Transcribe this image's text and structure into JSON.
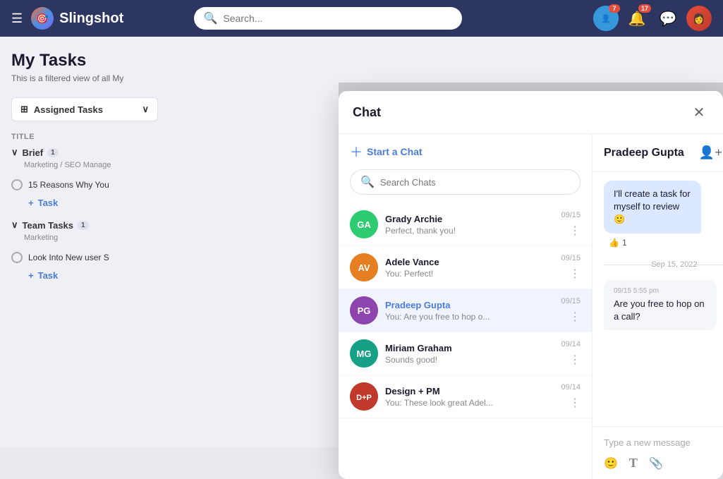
{
  "app": {
    "name": "Slingshot",
    "search_placeholder": "Search..."
  },
  "nav": {
    "badges": {
      "notifications": "7",
      "alerts": "17"
    }
  },
  "sidebar": {
    "title": "My Tasks",
    "subtitle": "This is a filtered view of all My",
    "assigned_tasks_label": "Assigned Tasks",
    "col_header": "Title",
    "groups": [
      {
        "name": "Brief",
        "count": "1",
        "sub": "Marketing / SEO Manage",
        "tasks": [
          "15 Reasons Why You"
        ]
      },
      {
        "name": "Team Tasks",
        "count": "1",
        "sub": "Marketing",
        "tasks": [
          "Look Into New user S"
        ]
      }
    ],
    "add_task_label": "Task"
  },
  "chat_modal": {
    "title": "Chat",
    "close_label": "×",
    "start_chat_label": "Start a Chat",
    "search_placeholder": "Search Chats",
    "contacts": [
      {
        "name": "Grady Archie",
        "preview": "Perfect, thank you!",
        "date": "09/15",
        "avatar_color": "#2ecc71",
        "initials": "GA",
        "active": false
      },
      {
        "name": "Adele Vance",
        "preview": "You: Perfect!",
        "date": "09/15",
        "avatar_color": "#e67e22",
        "initials": "AV",
        "active": false
      },
      {
        "name": "Pradeep Gupta",
        "preview": "You: Are you free to hop o...",
        "date": "09/15",
        "avatar_color": "#8e44ad",
        "initials": "PG",
        "active": true
      },
      {
        "name": "Miriam Graham",
        "preview": "Sounds good!",
        "date": "09/14",
        "avatar_color": "#16a085",
        "initials": "MG",
        "active": false
      },
      {
        "name": "Design + PM",
        "preview": "You: These look great Adel...",
        "date": "09/14",
        "avatar_color": "#c0392b",
        "initials": "D+",
        "active": false
      }
    ],
    "conversation": {
      "contact_name": "Pradeep Gupta",
      "messages": [
        {
          "type": "sent",
          "text": "I'll create a task for myself to review 🙂",
          "reaction": "👍",
          "reaction_count": "1"
        }
      ],
      "date_divider": "Sep 15, 2022",
      "received_messages": [
        {
          "time": "09/15 5:55 pm",
          "text": "Are you free to hop on a call?"
        }
      ],
      "input_placeholder": "Type a new message"
    }
  }
}
